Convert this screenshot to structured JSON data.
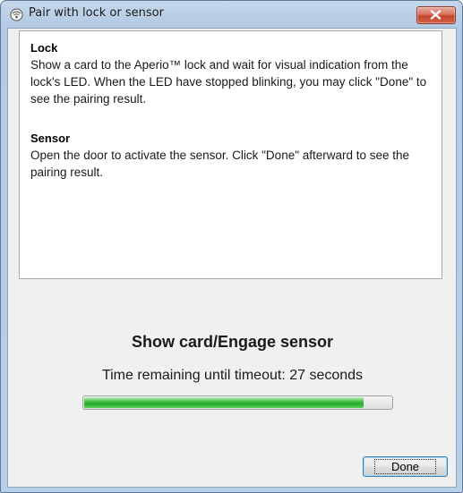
{
  "window": {
    "title": "Pair with lock or sensor",
    "icon": "pair-lock-icon",
    "close_icon": "close-icon"
  },
  "instructions": {
    "lock_heading": "Lock",
    "lock_text": "Show a card to the Aperio™ lock and wait for visual indication from the lock's LED. When the LED have stopped blinking, you may click \"Done\" to see the pairing result.",
    "sensor_heading": "Sensor",
    "sensor_text": "Open the door to activate the sensor. Click \"Done\" afterward to see the pairing result."
  },
  "status": {
    "heading": "Show card/Engage sensor",
    "timeout_text": "Time remaining until timeout: 27 seconds",
    "progress_fraction": 0.91
  },
  "buttons": {
    "done_label": "Done"
  },
  "colors": {
    "progress_green": "#2fb437",
    "close_red": "#c9452e"
  }
}
